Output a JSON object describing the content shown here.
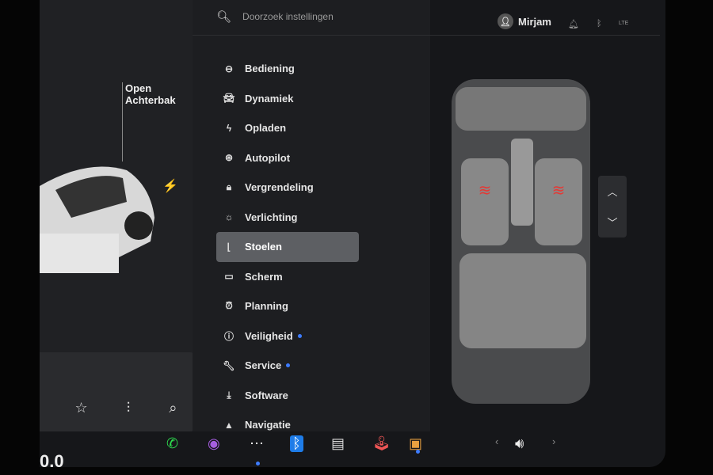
{
  "left": {
    "trunk_label": "Open Achterbak",
    "speed": "0.0",
    "charge_icon": "bolt-icon"
  },
  "topbar": {
    "search_placeholder": "Doorzoek instellingen",
    "user": "Mirjam",
    "signal": "LTE"
  },
  "menu": {
    "items": [
      {
        "label": "Bediening",
        "icon": "toggle-icon"
      },
      {
        "label": "Dynamiek",
        "icon": "car-icon"
      },
      {
        "label": "Opladen",
        "icon": "bolt-icon"
      },
      {
        "label": "Autopilot",
        "icon": "steering-wheel-icon"
      },
      {
        "label": "Vergrendeling",
        "icon": "lock-icon"
      },
      {
        "label": "Verlichting",
        "icon": "sun-icon"
      },
      {
        "label": "Stoelen",
        "icon": "seat-icon",
        "active": true
      },
      {
        "label": "Scherm",
        "icon": "display-icon"
      },
      {
        "label": "Planning",
        "icon": "alarm-icon"
      },
      {
        "label": "Veiligheid",
        "icon": "info-icon",
        "notification": true
      },
      {
        "label": "Service",
        "icon": "wrench-icon",
        "notification": true
      },
      {
        "label": "Software",
        "icon": "download-icon"
      },
      {
        "label": "Navigatie",
        "icon": "navigation-icon"
      }
    ]
  },
  "seats": {
    "heater_color": "#e53935",
    "driver_heat": "on",
    "passenger_heat": "on"
  },
  "colors": {
    "accent": "#3d7cff",
    "active_item": "#5d5f63"
  }
}
